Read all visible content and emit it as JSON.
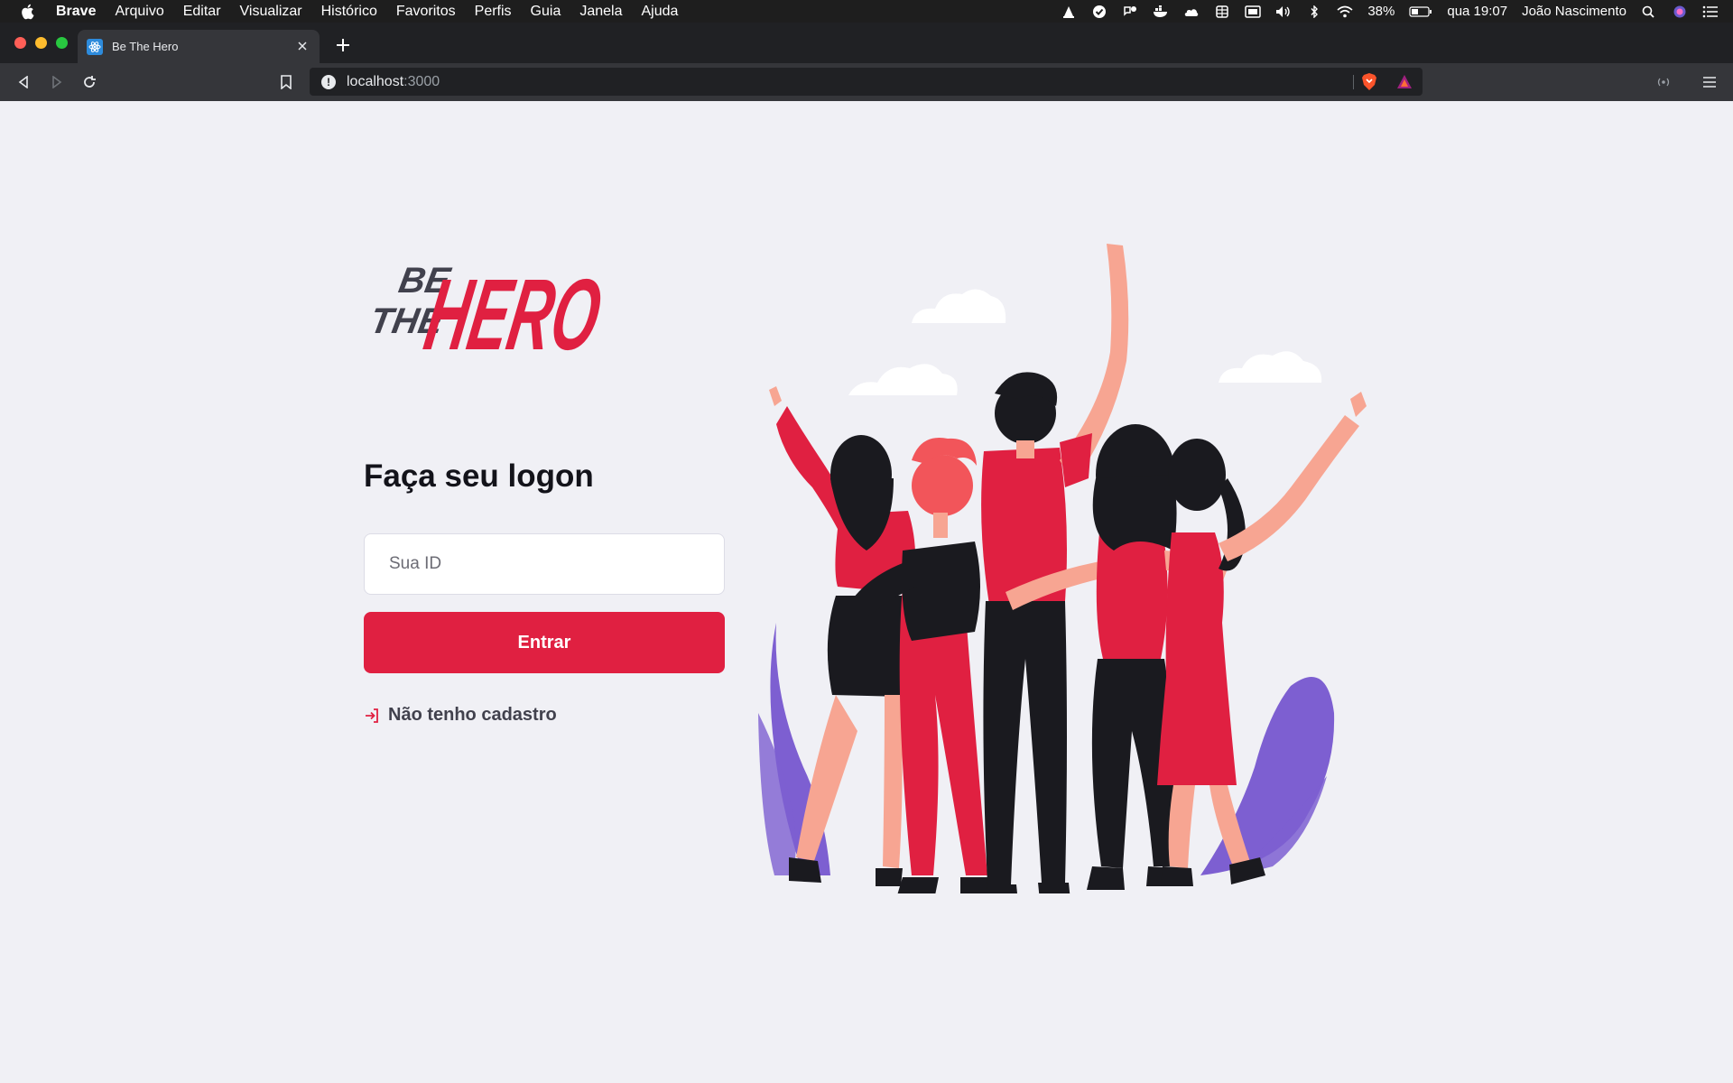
{
  "menubar": {
    "items": [
      "Brave",
      "Arquivo",
      "Editar",
      "Visualizar",
      "Histórico",
      "Favoritos",
      "Perfis",
      "Guia",
      "Janela",
      "Ajuda"
    ],
    "battery": "38%",
    "clock": "qua 19:07",
    "user": "João Nascimento"
  },
  "browser": {
    "tab_title": "Be The Hero",
    "url_host": "localhost",
    "url_port": ":3000"
  },
  "login": {
    "heading": "Faça seu logon",
    "id_placeholder": "Sua ID",
    "submit_label": "Entrar",
    "register_link": "Não tenho cadastro"
  },
  "logo": {
    "line1": "BE",
    "line2": "THE",
    "line3": "HERO"
  },
  "colors": {
    "accent": "#e02041",
    "background": "#f0f0f5",
    "text_dark": "#13131a",
    "text_link": "#41414d",
    "logo_dark": "#41414d",
    "plant_purple": "#7d5fd1"
  },
  "icons": [
    "apple-icon",
    "vlc-icon",
    "check-icon",
    "notification-icon",
    "docker-icon",
    "cloud-icon",
    "grid-icon",
    "display-icon",
    "volume-icon",
    "bluetooth-icon",
    "wifi-icon",
    "battery-icon",
    "search-icon",
    "siri-icon",
    "control-center-icon",
    "back-icon",
    "forward-icon",
    "reload-icon",
    "bookmark-icon",
    "info-icon",
    "brave-shield-icon",
    "brave-rewards-icon",
    "extension-icon",
    "menu-icon",
    "log-in-icon"
  ]
}
